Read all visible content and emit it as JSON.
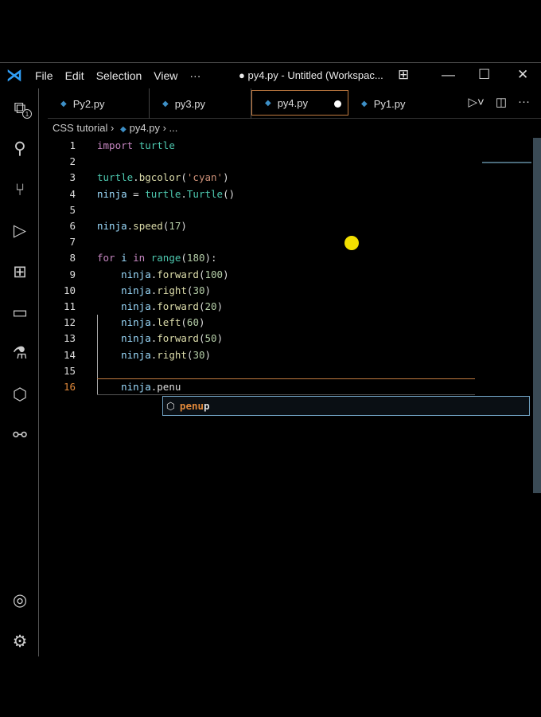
{
  "titlebar": {
    "menu": [
      "File",
      "Edit",
      "Selection",
      "View",
      "···"
    ],
    "title": "● py4.py - Untitled (Workspac..."
  },
  "tabs": [
    {
      "label": "Py2.py"
    },
    {
      "label": "py3.py"
    },
    {
      "label": "py4.py",
      "modified": true
    },
    {
      "label": "Py1.py"
    }
  ],
  "explorer_badge": "1",
  "breadcrumb": {
    "folder": "CSS tutorial",
    "file": "py4.py",
    "more": "..."
  },
  "code": [
    [
      [
        "k",
        "import"
      ],
      [
        "p",
        " "
      ],
      [
        "t",
        "turtle"
      ]
    ],
    [],
    [
      [
        "t",
        "turtle"
      ],
      [
        "p",
        "."
      ],
      [
        "f",
        "bgcolor"
      ],
      [
        "p",
        "("
      ],
      [
        "s",
        "'cyan'"
      ],
      [
        "p",
        ")"
      ]
    ],
    [
      [
        "v",
        "ninja"
      ],
      [
        "p",
        " = "
      ],
      [
        "t",
        "turtle"
      ],
      [
        "p",
        "."
      ],
      [
        "t",
        "Turtle"
      ],
      [
        "p",
        "()"
      ]
    ],
    [],
    [
      [
        "v",
        "ninja"
      ],
      [
        "p",
        "."
      ],
      [
        "f",
        "speed"
      ],
      [
        "p",
        "("
      ],
      [
        "n",
        "17"
      ],
      [
        "p",
        ")"
      ]
    ],
    [],
    [
      [
        "k",
        "for"
      ],
      [
        "v",
        " i "
      ],
      [
        "k",
        "in"
      ],
      [
        "p",
        " "
      ],
      [
        "t",
        "range"
      ],
      [
        "p",
        "("
      ],
      [
        "n",
        "180"
      ],
      [
        "p",
        "):"
      ]
    ],
    [
      [
        "p",
        "    "
      ],
      [
        "v",
        "ninja"
      ],
      [
        "p",
        "."
      ],
      [
        "f",
        "forward"
      ],
      [
        "p",
        "("
      ],
      [
        "n",
        "100"
      ],
      [
        "p",
        ")"
      ]
    ],
    [
      [
        "p",
        "    "
      ],
      [
        "v",
        "ninja"
      ],
      [
        "p",
        "."
      ],
      [
        "f",
        "right"
      ],
      [
        "p",
        "("
      ],
      [
        "n",
        "30"
      ],
      [
        "p",
        ")"
      ]
    ],
    [
      [
        "p",
        "    "
      ],
      [
        "v",
        "ninja"
      ],
      [
        "p",
        "."
      ],
      [
        "f",
        "forward"
      ],
      [
        "p",
        "("
      ],
      [
        "n",
        "20"
      ],
      [
        "p",
        ")"
      ]
    ],
    [
      [
        "p",
        "    "
      ],
      [
        "v",
        "ninja"
      ],
      [
        "p",
        "."
      ],
      [
        "f",
        "left"
      ],
      [
        "p",
        "("
      ],
      [
        "n",
        "60"
      ],
      [
        "p",
        ")"
      ]
    ],
    [
      [
        "p",
        "    "
      ],
      [
        "v",
        "ninja"
      ],
      [
        "p",
        "."
      ],
      [
        "f",
        "forward"
      ],
      [
        "p",
        "("
      ],
      [
        "n",
        "50"
      ],
      [
        "p",
        ")"
      ]
    ],
    [
      [
        "p",
        "    "
      ],
      [
        "v",
        "ninja"
      ],
      [
        "p",
        "."
      ],
      [
        "f",
        "right"
      ],
      [
        "p",
        "("
      ],
      [
        "n",
        "30"
      ],
      [
        "p",
        ")"
      ]
    ],
    [],
    [
      [
        "p",
        "    "
      ],
      [
        "v",
        "ninja"
      ],
      [
        "p",
        ".penu"
      ]
    ]
  ],
  "current_line": 16,
  "suggestion": {
    "match": "penu",
    "rest": "p"
  }
}
